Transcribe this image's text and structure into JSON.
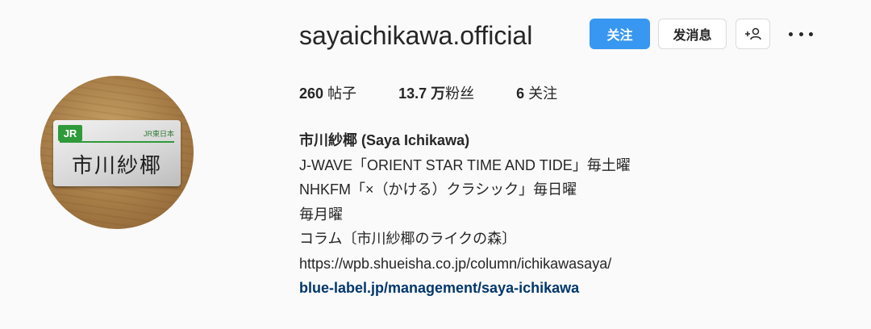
{
  "profile": {
    "username": "sayaichikawa.official",
    "buttons": {
      "follow": "关注",
      "message": "发消息"
    },
    "stats": [
      {
        "value": "260",
        "label": "帖子"
      },
      {
        "value": "13.7 万",
        "label": "粉丝"
      },
      {
        "value": "6",
        "label": "关注"
      }
    ],
    "bio": {
      "full_name": "市川紗椰 (Saya Ichikawa)",
      "lines": [
        "J-WAVE「ORIENT STAR TIME AND TIDE」毎土曜",
        "NHKFM「×（かける）クラシック」毎日曜",
        "毎月曜",
        "コラム〔市川紗椰のライクの森〕",
        "https://wpb.shueisha.co.jp/column/ichikawasaya/"
      ],
      "link": "blue-label.jp/management/saya-ichikawa"
    },
    "avatar": {
      "badge_logo": "JR",
      "badge_company": "JR東日本",
      "badge_name": "市川紗椰"
    }
  },
  "icons": {
    "suggest": "add-person-icon",
    "more": "more-options-icon"
  },
  "colors": {
    "accent": "#3897f0",
    "link": "#00376b",
    "background": "#fafafa",
    "text": "#262626"
  }
}
